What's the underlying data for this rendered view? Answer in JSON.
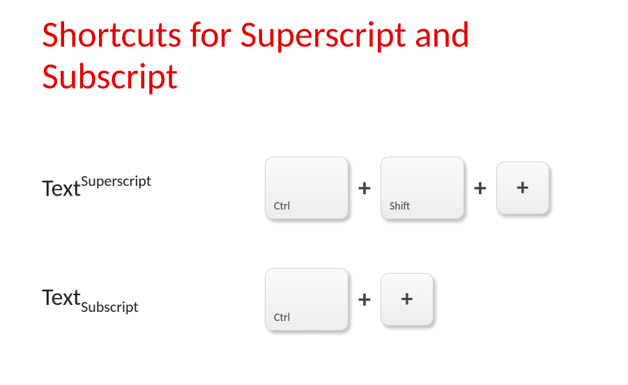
{
  "title": "Shortcuts for Superscript and Subscript",
  "rows": {
    "super": {
      "base": "Text",
      "script": "Superscript",
      "keys": {
        "k1": "Ctrl",
        "k2": "Shift",
        "k3": "+"
      },
      "plus": "+"
    },
    "sub": {
      "base": "Text",
      "script": "Subscript",
      "keys": {
        "k1": "Ctrl",
        "k2": "+"
      },
      "plus": "+"
    }
  }
}
